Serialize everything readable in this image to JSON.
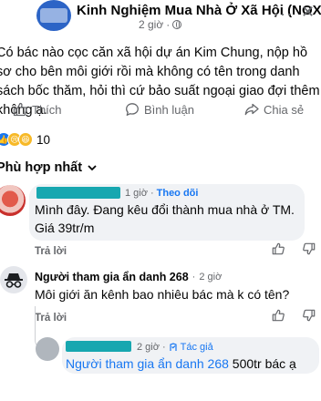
{
  "post": {
    "group_name": "Kinh Nghiệm Mua Nhà Ở Xã Hội (NOXH)",
    "time": "2 giờ",
    "text": "Có bác nào cọc căn xã hội dự án Kim Chung, nộp hồ sơ cho bên môi giới rồi mà không có tên trong danh sách bốc thăm, hỏi thì cứ bảo suất ngoại giao đợi thêm không ạ.",
    "actions": {
      "like": "Thích",
      "comment": "Bình luận",
      "share": "Chia sẻ"
    },
    "reaction_count": "10"
  },
  "sort_label": "Phù hợp nhất",
  "comments": [
    {
      "time": "1 giờ",
      "follow_label": "Theo dõi",
      "text": "Mình đây. Đang kêu đổi thành mua nhà ở TM. Giá 39tr/m",
      "reply_label": "Trả lời"
    },
    {
      "author": "Người tham gia ẩn danh 268",
      "time": "2 giờ",
      "text": "Môi giới ăn kênh bao nhiêu bác mà k có tên?",
      "reply_label": "Trả lời"
    },
    {
      "time": "2 giờ",
      "author_badge": "Tác giả",
      "mention": "Người tham gia ẩn danh 268",
      "text": " 500tr bác ạ"
    }
  ],
  "colors": {
    "accent": "#1877f2",
    "redaction": "#17a7b0",
    "muted": "#65676b"
  },
  "icons": [
    "globe-icon",
    "more-icon",
    "close-icon",
    "like-icon",
    "comment-icon",
    "share-icon",
    "like-reaction-icon",
    "sad-reaction-icon",
    "haha-reaction-icon",
    "chevron-down-icon",
    "thumbs-up-icon",
    "thumbs-down-icon",
    "incognito-icon",
    "author-badge-icon"
  ]
}
